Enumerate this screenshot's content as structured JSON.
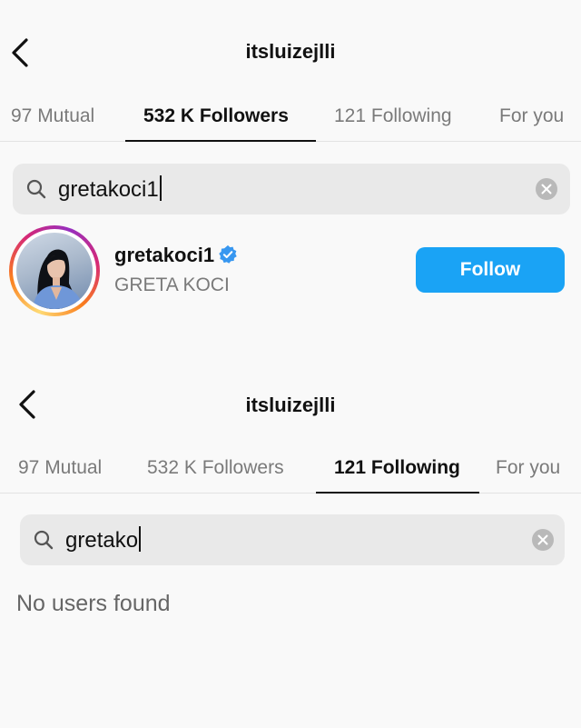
{
  "top_screen": {
    "header": {
      "username": "itsluizejlli"
    },
    "tabs": [
      {
        "label": "97 Mutual",
        "active": false
      },
      {
        "label": "532 K Followers",
        "active": true
      },
      {
        "label": "121 Following",
        "active": false
      },
      {
        "label": "For you",
        "active": false
      }
    ],
    "search": {
      "value": "gretakoci1"
    },
    "result": {
      "handle": "gretakoci1",
      "verified": true,
      "full_name": "GRETA KOCI",
      "follow_label": "Follow"
    }
  },
  "bottom_screen": {
    "header": {
      "username": "itsluizejlli"
    },
    "tabs": [
      {
        "label": "97 Mutual",
        "active": false
      },
      {
        "label": "532 K Followers",
        "active": false
      },
      {
        "label": "121 Following",
        "active": true
      },
      {
        "label": "For you",
        "active": false
      }
    ],
    "search": {
      "value": "gretako"
    },
    "empty_message": "No users found"
  },
  "colors": {
    "accent_blue": "#1aa3f5",
    "verified_blue": "#3897f0",
    "muted_text": "#7a7a7a",
    "background": "#f9f9f9"
  },
  "icons": {
    "back": "chevron-left-icon",
    "search": "magnifier-icon",
    "clear": "x-circle-icon",
    "verified": "verified-badge-icon"
  }
}
